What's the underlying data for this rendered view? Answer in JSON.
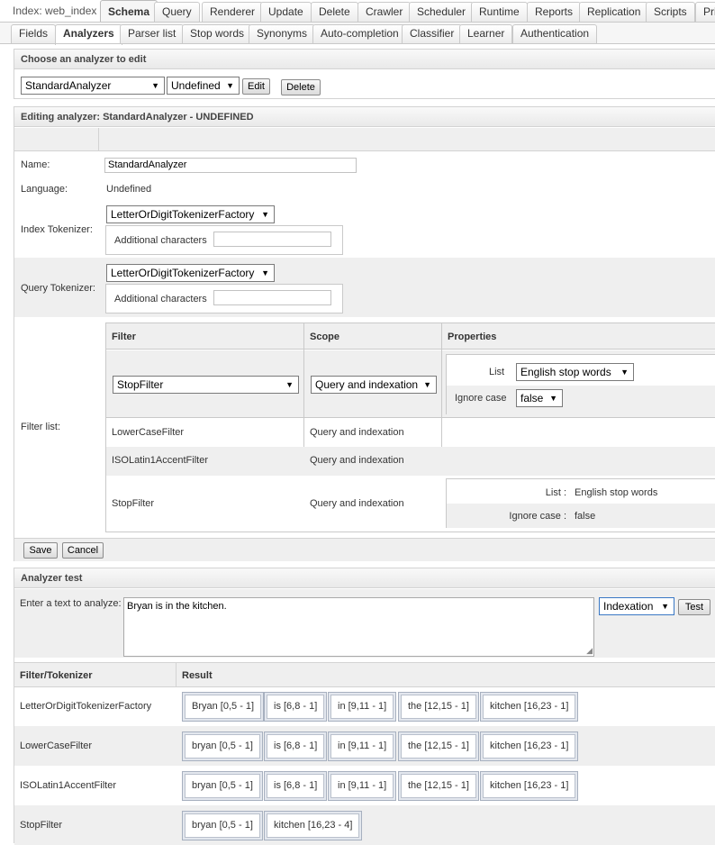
{
  "top_tabs": {
    "index": "Index: web_index",
    "items": [
      "Schema",
      "Query",
      "Renderer",
      "Update",
      "Delete",
      "Crawler",
      "Scheduler",
      "Runtime",
      "Reports",
      "Replication",
      "Scripts",
      "Pri"
    ]
  },
  "sub_tabs": [
    "Fields",
    "Analyzers",
    "Parser list",
    "Stop words",
    "Synonyms",
    "Auto-completion",
    "Classifier",
    "Learner",
    "Authentication"
  ],
  "chooser": {
    "title": "Choose an analyzer to edit",
    "analyzer": "StandardAnalyzer",
    "language": "Undefined",
    "edit": "Edit",
    "delete": "Delete"
  },
  "editor": {
    "title": "Editing analyzer: StandardAnalyzer - UNDEFINED",
    "name_label": "Name:",
    "name_value": "StandardAnalyzer",
    "language_label": "Language:",
    "language_value": "Undefined",
    "index_tokenizer_label": "Index Tokenizer:",
    "index_tokenizer": "LetterOrDigitTokenizerFactory",
    "query_tokenizer_label": "Query Tokenizer:",
    "query_tokenizer": "LetterOrDigitTokenizerFactory",
    "additional_chars_label": "Additional characters",
    "filter_list_label": "Filter list:",
    "filter_headers": [
      "Filter",
      "Scope",
      "Properties"
    ],
    "new_filter": {
      "filter": "StopFilter",
      "scope": "Query and indexation",
      "list_label": "List",
      "list_value": "English stop words",
      "ignore_label": "Ignore case",
      "ignore_value": "false"
    },
    "filters": [
      {
        "filter": "LowerCaseFilter",
        "scope": "Query and indexation"
      },
      {
        "filter": "ISOLatin1AccentFilter",
        "scope": "Query and indexation"
      },
      {
        "filter": "StopFilter",
        "scope": "Query and indexation",
        "list_label": "List :",
        "list_value": "English stop words",
        "ignore_label": "Ignore case :",
        "ignore_value": "false"
      }
    ],
    "save": "Save",
    "cancel": "Cancel"
  },
  "test": {
    "title": "Analyzer test",
    "prompt": "Enter a text to analyze:",
    "text": "Bryan is in the kitchen.",
    "mode": "Indexation",
    "test_button": "Test",
    "headers": [
      "Filter/Tokenizer",
      "Result"
    ],
    "rows": [
      {
        "name": "LetterOrDigitTokenizerFactory",
        "tokens": [
          "Bryan [0,5 - 1]",
          "is [6,8 - 1]",
          "in [9,11 - 1]",
          "the [12,15 - 1]",
          "kitchen [16,23 - 1]"
        ]
      },
      {
        "name": "LowerCaseFilter",
        "tokens": [
          "bryan [0,5 - 1]",
          "is [6,8 - 1]",
          "in [9,11 - 1]",
          "the [12,15 - 1]",
          "kitchen [16,23 - 1]"
        ]
      },
      {
        "name": "ISOLatin1AccentFilter",
        "tokens": [
          "bryan [0,5 - 1]",
          "is [6,8 - 1]",
          "in [9,11 - 1]",
          "the [12,15 - 1]",
          "kitchen [16,23 - 1]"
        ]
      },
      {
        "name": "StopFilter",
        "tokens": [
          "bryan [0,5 - 1]",
          "kitchen [16,23 - 4]"
        ]
      }
    ]
  }
}
